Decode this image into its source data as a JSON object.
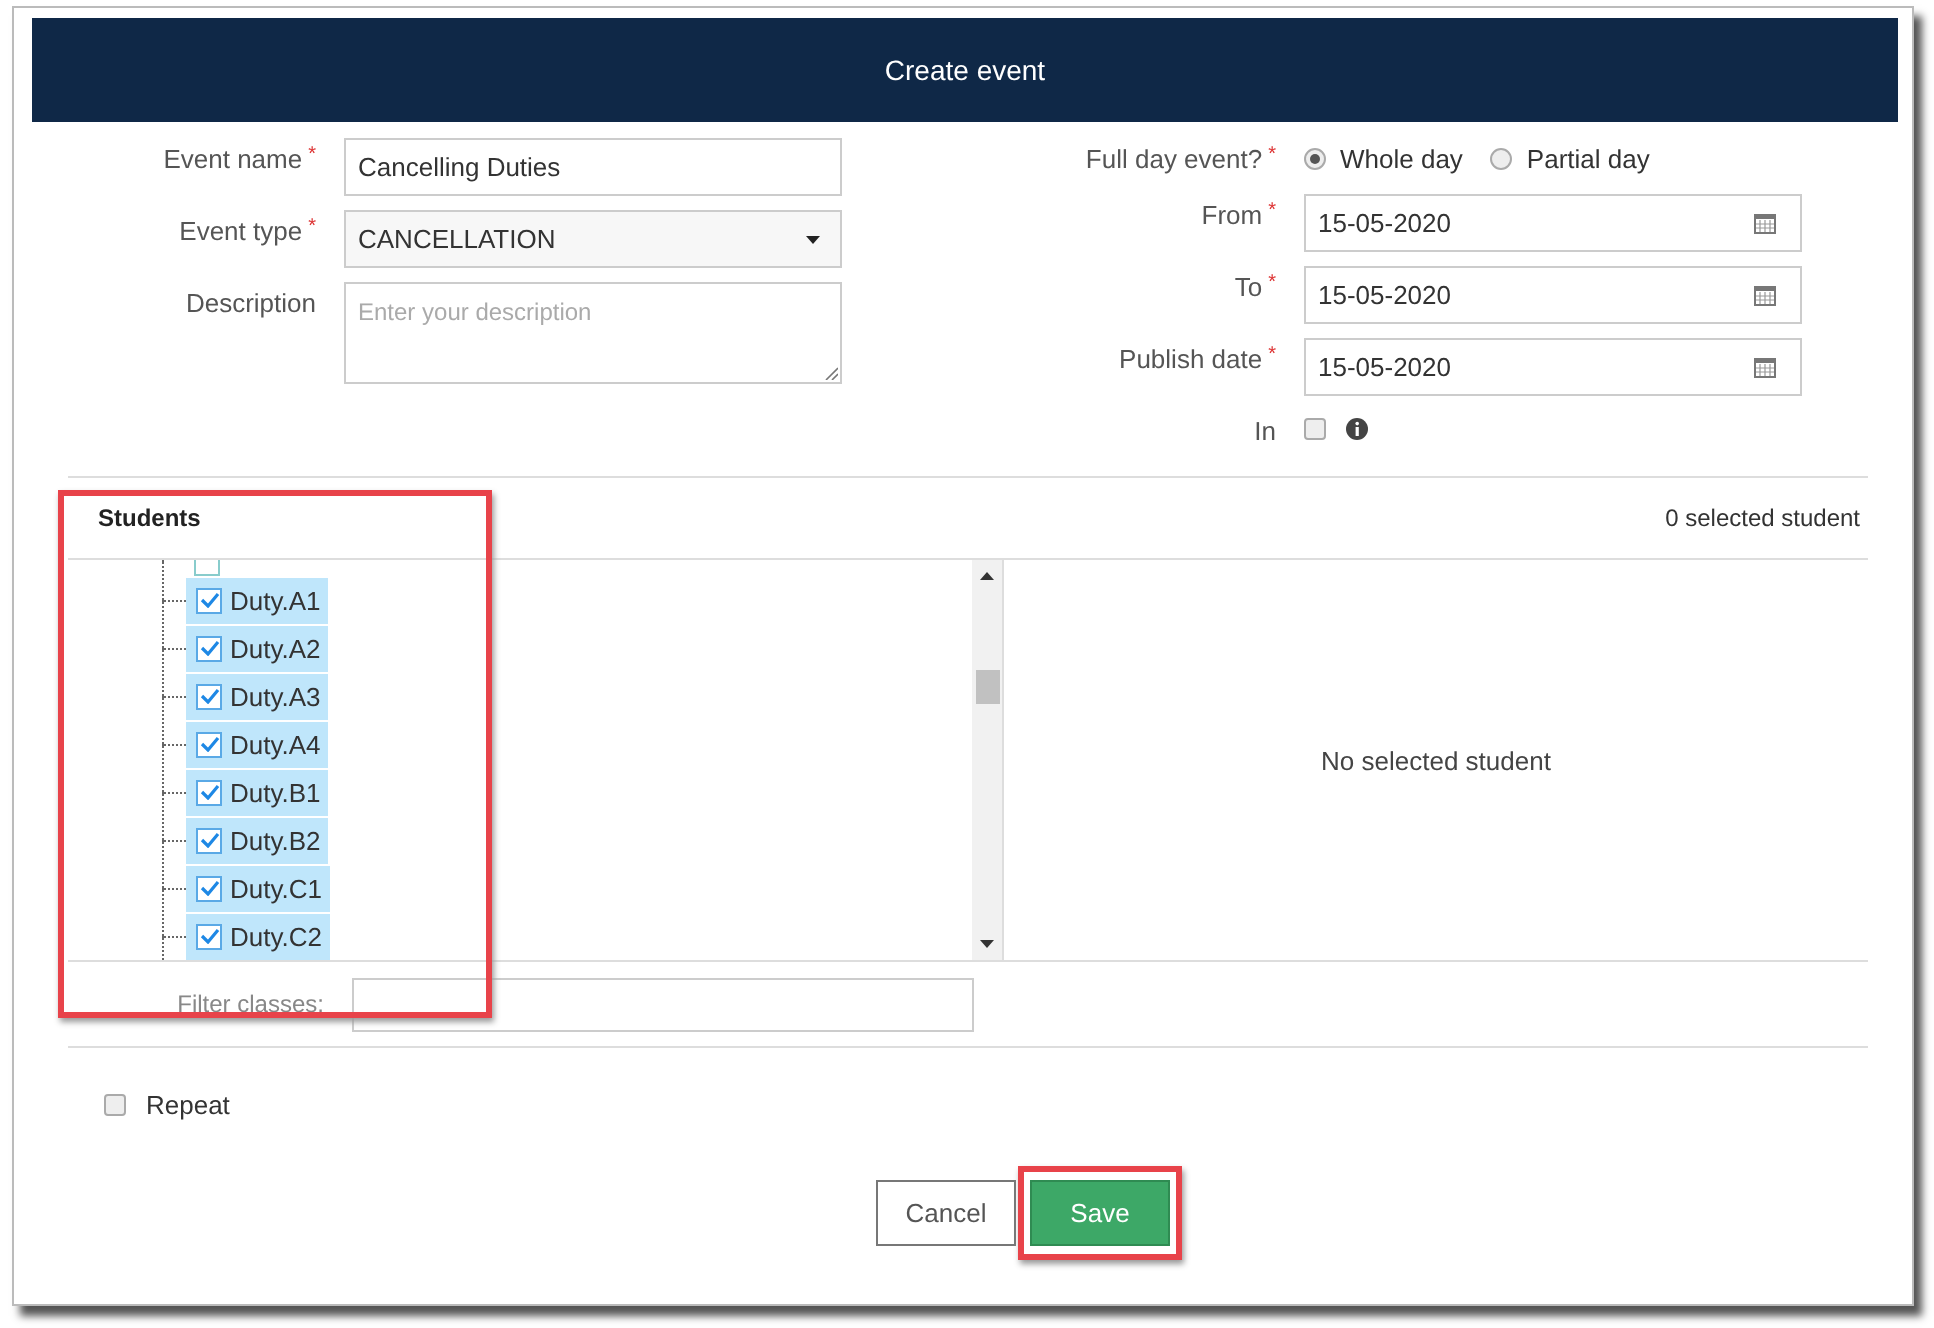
{
  "dialog": {
    "title": "Create event"
  },
  "left_fields": [
    {
      "kind": "text",
      "label": "Event name",
      "required_mark": "*",
      "value": "Cancelling Duties"
    },
    {
      "kind": "select",
      "label": "Event type",
      "required_mark": "*",
      "value": "CANCELLATION"
    },
    {
      "kind": "textarea",
      "label": "Description",
      "placeholder": "Enter your description"
    }
  ],
  "full_day": {
    "label": "Full day event?",
    "required_mark": "*",
    "options": [
      {
        "label": "Whole day",
        "selected": true
      },
      {
        "label": "Partial day",
        "selected": false
      }
    ]
  },
  "date_fields": [
    {
      "label": "From",
      "required_mark": "*",
      "value": "15-05-2020"
    },
    {
      "label": "To",
      "required_mark": "*",
      "value": "15-05-2020"
    },
    {
      "label": "Publish date",
      "required_mark": "*",
      "value": "15-05-2020"
    }
  ],
  "in_option": {
    "label": "In",
    "checked": false
  },
  "students": {
    "title": "Students",
    "selected_count": "0 selected student",
    "empty_text": "No selected student",
    "filter_label": "Filter classes:",
    "classes": [
      {
        "label": "Duty.A1",
        "checked": true
      },
      {
        "label": "Duty.A2",
        "checked": true
      },
      {
        "label": "Duty.A3",
        "checked": true
      },
      {
        "label": "Duty.A4",
        "checked": true
      },
      {
        "label": "Duty.B1",
        "checked": true
      },
      {
        "label": "Duty.B2",
        "checked": true
      },
      {
        "label": "Duty.C1",
        "checked": true
      },
      {
        "label": "Duty.C2",
        "checked": true
      }
    ]
  },
  "repeat": {
    "label": "Repeat",
    "checked": false
  },
  "buttons": [
    {
      "kind": "secondary",
      "label": "Cancel"
    },
    {
      "kind": "primary",
      "label": "Save"
    }
  ]
}
